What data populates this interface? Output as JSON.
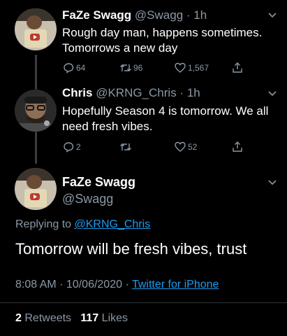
{
  "tweets": [
    {
      "name": "FaZe Swagg",
      "handle": "@Swagg",
      "time": "1h",
      "text": "Rough day man, happens sometimes. Tomorrows a new day",
      "replies": "64",
      "retweets": "96",
      "likes": "1,567"
    },
    {
      "name": "Chris",
      "handle": "@KRNG_Chris",
      "time": "1h",
      "text": "Hopefully Season 4 is tomorrow. We all need fresh vibes.",
      "replies": "2",
      "retweets": "",
      "likes": "52"
    }
  ],
  "focused": {
    "name": "FaZe Swagg",
    "handle": "@Swagg",
    "replying_prefix": "Replying to",
    "replying_handle": "@KRNG_Chris",
    "text": "Tomorrow will be fresh vibes, trust",
    "timestamp": "8:08 AM · 10/06/2020 ·",
    "source": "Twitter for iPhone",
    "retweets_count": "2",
    "retweets_label": "Retweets",
    "likes_count": "117",
    "likes_label": "Likes"
  },
  "colors": {
    "accent": "#1d9bf0",
    "muted": "#8b98a5",
    "background": "#000000"
  },
  "icons": [
    "chevron-down-icon",
    "reply-icon",
    "retweet-icon",
    "like-icon",
    "share-icon"
  ]
}
